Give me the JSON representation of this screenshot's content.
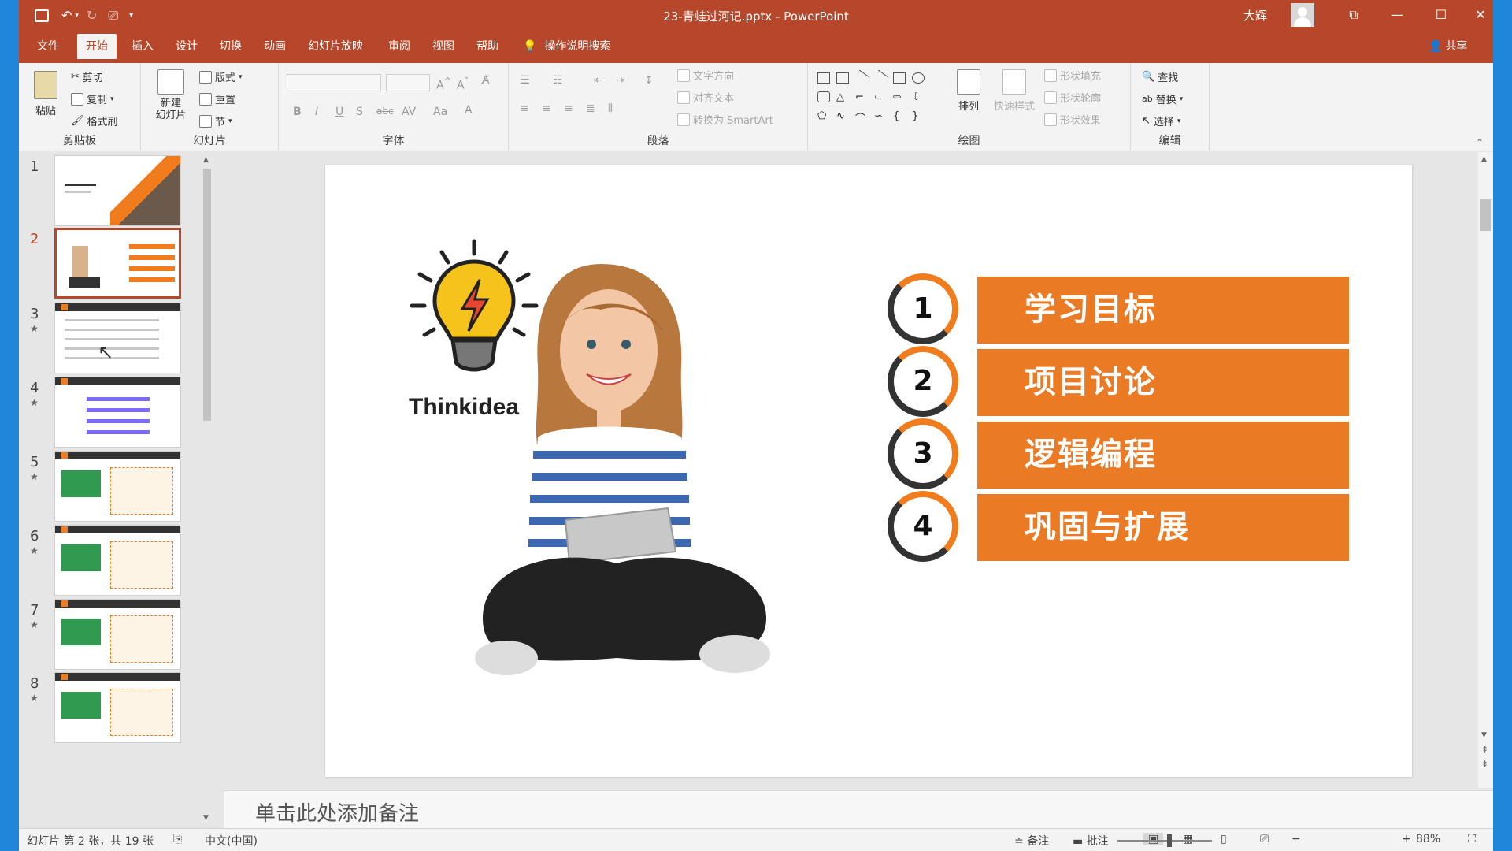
{
  "window": {
    "title": "23-青蛙过河记.pptx - PowerPoint",
    "user": "大辉",
    "controls": [
      "ribbon-display",
      "minimize",
      "maximize",
      "close"
    ]
  },
  "tabs": [
    "文件",
    "开始",
    "插入",
    "设计",
    "切换",
    "动画",
    "幻灯片放映",
    "审阅",
    "视图",
    "帮助"
  ],
  "active_tab": "开始",
  "tell_me": "操作说明搜索",
  "share": "共享",
  "ribbon": {
    "clipboard": {
      "label": "剪贴板",
      "paste": "粘贴",
      "cut": "剪切",
      "copy": "复制",
      "format_painter": "格式刷"
    },
    "slides": {
      "label": "幻灯片",
      "new_slide": "新建\n幻灯片",
      "layout": "版式",
      "reset": "重置",
      "section": "节"
    },
    "font": {
      "label": "字体"
    },
    "paragraph": {
      "label": "段落",
      "text_direction": "文字方向",
      "align_text": "对齐文本",
      "smartart": "转换为 SmartArt"
    },
    "drawing": {
      "label": "绘图",
      "arrange": "排列",
      "quick_styles": "快速样式",
      "fill": "形状填充",
      "outline": "形状轮廓",
      "effects": "形状效果"
    },
    "editing": {
      "label": "编辑",
      "find": "查找",
      "replace": "替换",
      "select": "选择"
    }
  },
  "thumbnails": [
    {
      "num": "1",
      "star": false
    },
    {
      "num": "2",
      "star": false,
      "selected": true
    },
    {
      "num": "3",
      "star": true
    },
    {
      "num": "4",
      "star": true
    },
    {
      "num": "5",
      "star": true
    },
    {
      "num": "6",
      "star": true
    },
    {
      "num": "7",
      "star": true
    },
    {
      "num": "8",
      "star": true
    }
  ],
  "slide": {
    "logo_text": "Thinkidea",
    "agenda": [
      {
        "num": "1",
        "label": "学习目标"
      },
      {
        "num": "2",
        "label": "项目讨论"
      },
      {
        "num": "3",
        "label": "逻辑编程"
      },
      {
        "num": "4",
        "label": "巩固与扩展"
      }
    ],
    "colors": {
      "accent": "#eb7a25",
      "dark": "#333333",
      "titlebar": "#b7472a"
    }
  },
  "notes_placeholder": "单击此处添加备注",
  "status": {
    "slide_info": "幻灯片 第 2 张，共 19 张",
    "language": "中文(中国)",
    "notes_btn": "备注",
    "comments_btn": "批注",
    "zoom": "88%",
    "zoom_fraction": 0.55
  }
}
